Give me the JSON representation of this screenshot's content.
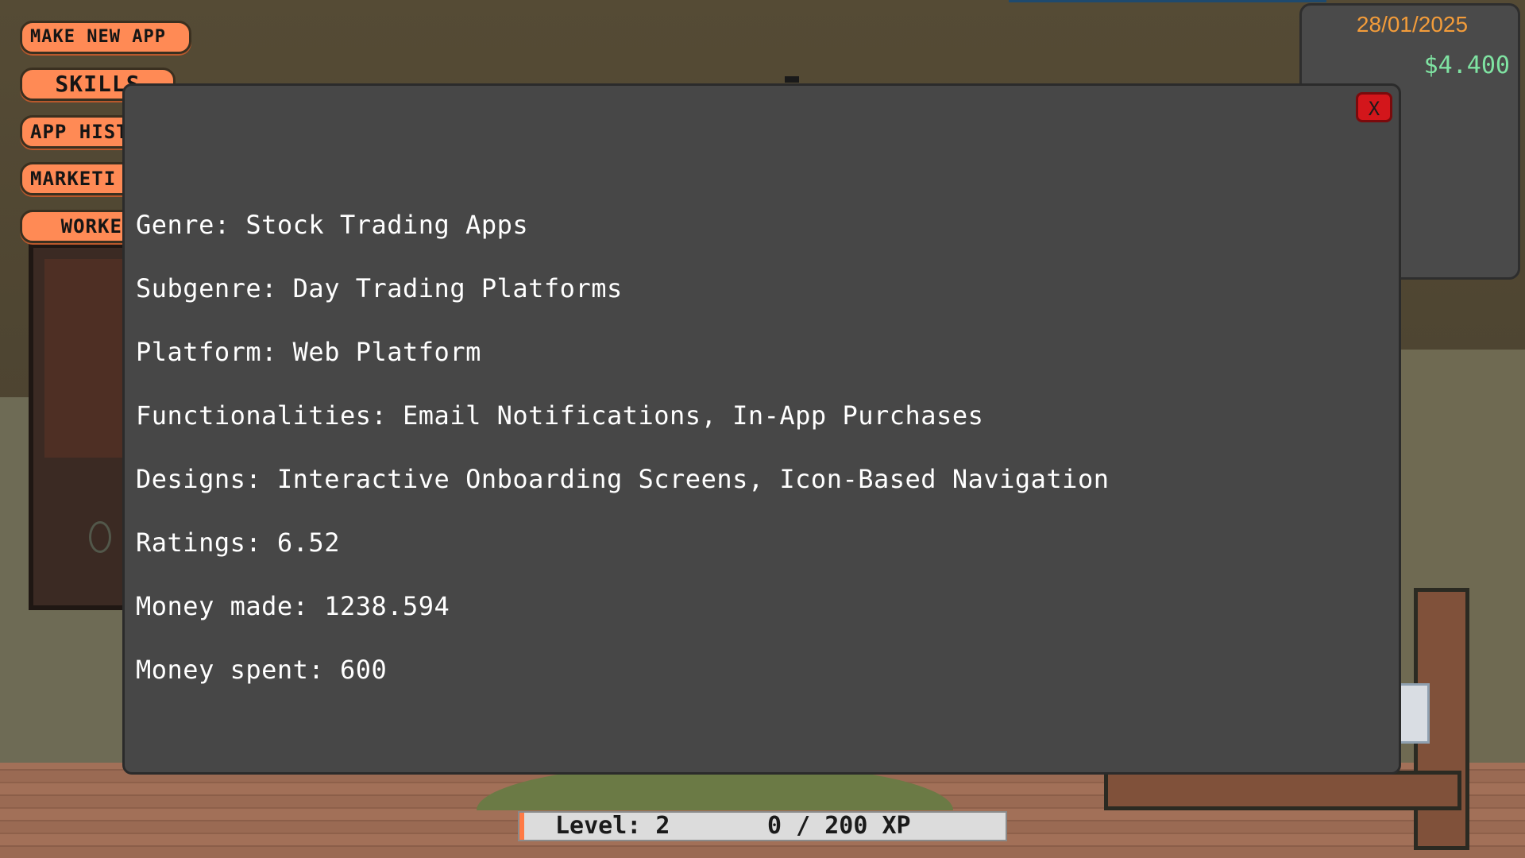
{
  "menu": {
    "make_new_app": "MAKE NEW APP",
    "skills": "SKILLS",
    "app_history": "APP HIST",
    "marketing": "MARKETI",
    "workers": "WORKER"
  },
  "stats": {
    "date": "28/01/2025",
    "money": "$4.400"
  },
  "modal": {
    "close_label": "X",
    "lines": [
      "Genre: Stock Trading Apps",
      "Subgenre: Day Trading Platforms",
      "Platform: Web Platform",
      "Functionalities: Email Notifications, In-App Purchases",
      "Designs: Interactive Onboarding Screens, Icon-Based Navigation",
      "Ratings: 6.52",
      "Money made: 1238.594",
      "Money spent: 600"
    ]
  },
  "xp": {
    "level_text": "Level: 2",
    "progress_text": "0 / 200 XP",
    "fraction": 0.01
  },
  "colors": {
    "menu_button": "#ff8a55",
    "close_button": "#d3161b",
    "date_text": "#f39c3a",
    "money_text": "#7fe3a2",
    "modal_bg": "#474747"
  }
}
